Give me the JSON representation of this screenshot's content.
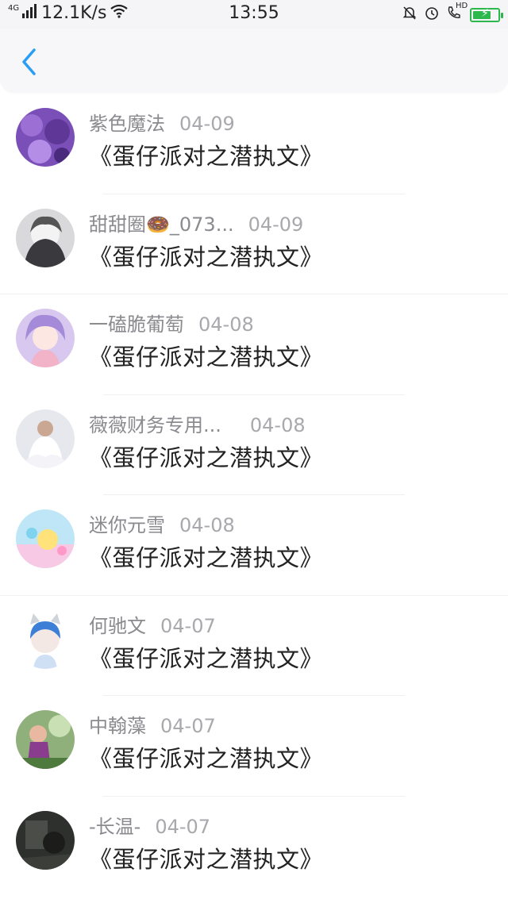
{
  "status_bar": {
    "network_type": "4G",
    "speed": "12.1K/s",
    "time": "13:55",
    "hd_label": "HD"
  },
  "header": {
    "back_icon": "chevron-left-icon",
    "accent_color": "#2a9ef5"
  },
  "items": [
    {
      "name": "紫色魔法",
      "date": "04-09",
      "content": "《蛋仔派对之潜执文》"
    },
    {
      "name": "甜甜圈🍩_073...",
      "date": "04-09",
      "content": "《蛋仔派对之潜执文》"
    },
    {
      "name": "一磕脆葡萄",
      "date": "04-08",
      "content": "《蛋仔派对之潜执文》"
    },
    {
      "name": "薇薇财务专用...",
      "date": "04-08",
      "content": "《蛋仔派对之潜执文》"
    },
    {
      "name": "迷你元雪",
      "date": "04-08",
      "content": "《蛋仔派对之潜执文》"
    },
    {
      "name": "何驰文",
      "date": "04-07",
      "content": "《蛋仔派对之潜执文》"
    },
    {
      "name": "中翰藻",
      "date": "04-07",
      "content": "《蛋仔派对之潜执文》"
    },
    {
      "name": "-长温-",
      "date": "04-07",
      "content": "《蛋仔派对之潜执文》"
    }
  ]
}
